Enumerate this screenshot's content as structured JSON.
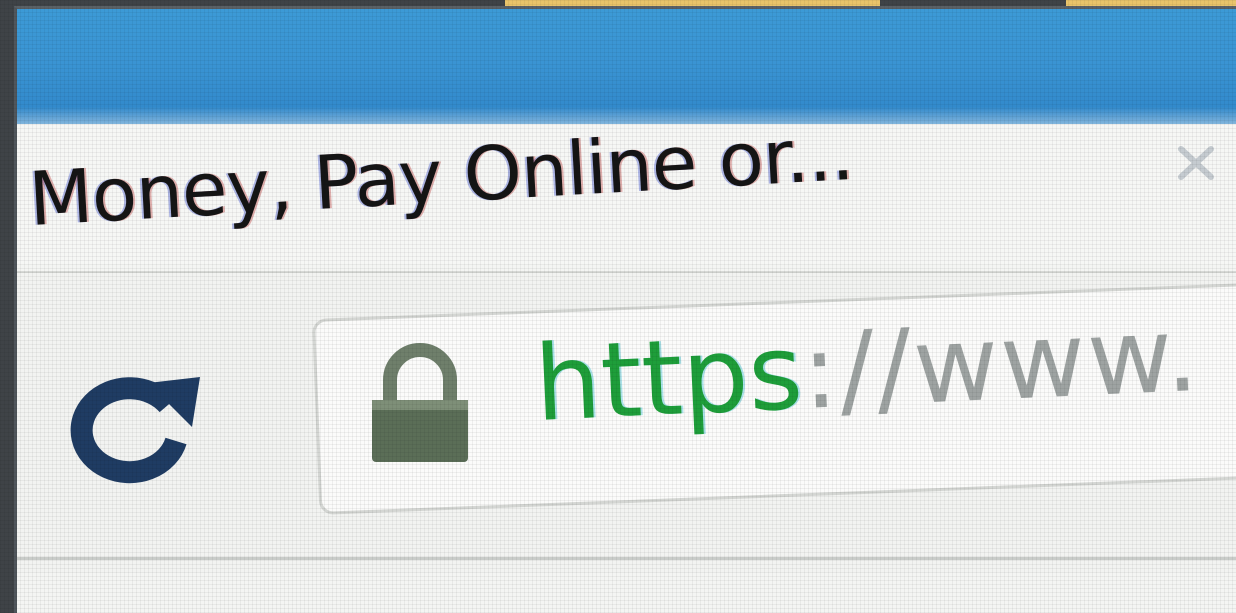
{
  "tab": {
    "title": "Money, Pay Online or...",
    "close_icon": "close-icon"
  },
  "toolbar": {
    "reload_icon": "reload-icon"
  },
  "address_bar": {
    "lock_icon": "lock-icon",
    "scheme": "https",
    "rest": "://www."
  },
  "colors": {
    "titlebar": "#3a94d3",
    "scheme": "#1e9e3a",
    "url_rest": "#9ea3a2",
    "lock": "#5b6e57",
    "reload": "#1f3c63"
  }
}
